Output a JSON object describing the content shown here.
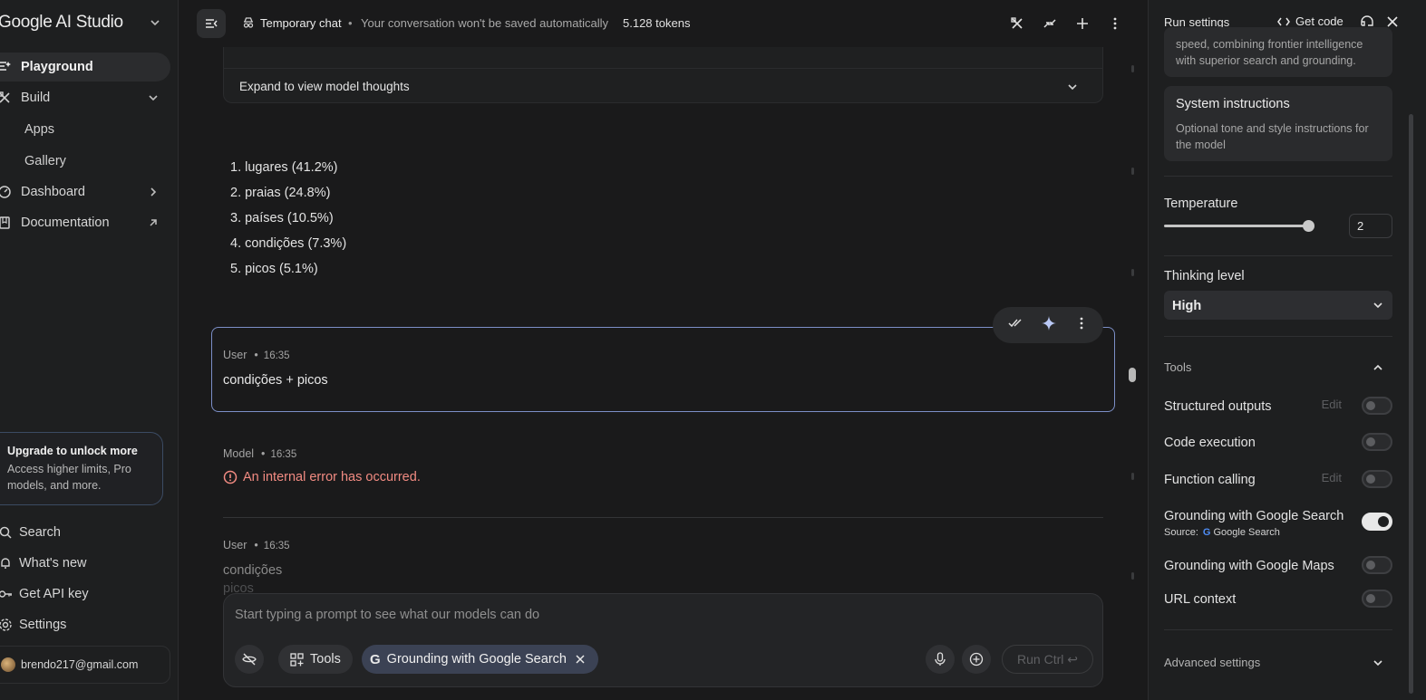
{
  "sidebar": {
    "brand": "Google AI Studio",
    "nav": {
      "playground": "Playground",
      "build": "Build",
      "apps": "Apps",
      "gallery": "Gallery",
      "dashboard": "Dashboard",
      "documentation": "Documentation"
    },
    "upgrade": {
      "title": "Upgrade to unlock more",
      "desc": "Access higher limits, Pro models, and more."
    },
    "bottom": {
      "search": "Search",
      "whats_new": "What's new",
      "api_key": "Get API key",
      "settings": "Settings"
    },
    "account_email": "brendo217@gmail.com"
  },
  "topbar": {
    "temp_title": "Temporary chat",
    "separator": "•",
    "temp_subtitle": "Your conversation won't be saved automatically",
    "tokens": "5.128 tokens"
  },
  "chat": {
    "thoughts_label": "Expand to view model thoughts",
    "list_items": [
      "1. lugares (41.2%)",
      "2. praias (24.8%)",
      "3. países (10.5%)",
      "4. condições (7.3%)",
      "5. picos (5.1%)"
    ],
    "messages": [
      {
        "role": "User",
        "time": "16:35",
        "text": "condições + picos"
      },
      {
        "role": "Model",
        "time": "16:35",
        "text": "An internal error has occurred."
      },
      {
        "role": "User",
        "time": "16:35",
        "text": "condições",
        "text2": "picos"
      }
    ],
    "dot": "•"
  },
  "prompt": {
    "placeholder": "Start typing a prompt to see what our models can do",
    "tools_label": "Tools",
    "grounding_chip": "Grounding with Google Search",
    "run_label": "Run Ctrl ↩"
  },
  "run_settings": {
    "title": "Run settings",
    "get_code": "Get code",
    "model_desc": "speed, combining frontier intelligence with superior search and grounding.",
    "system_instructions_title": "System instructions",
    "system_instructions_desc": "Optional tone and style instructions for the model",
    "temperature_label": "Temperature",
    "temperature_value": "2",
    "temperature_fraction": 1.0,
    "thinking_label": "Thinking level",
    "thinking_value": "High",
    "tools_heading": "Tools",
    "edit_label": "Edit",
    "tools": [
      {
        "name": "Structured outputs",
        "edit": true,
        "on": false
      },
      {
        "name": "Code execution",
        "edit": false,
        "on": false
      },
      {
        "name": "Function calling",
        "edit": true,
        "on": false
      },
      {
        "name": "Grounding with Google Search",
        "edit": false,
        "on": true
      },
      {
        "name": "Grounding with Google Maps",
        "edit": false,
        "on": false
      },
      {
        "name": "URL context",
        "edit": false,
        "on": false
      }
    ],
    "source_label": "Source:",
    "source_name": "Google Search",
    "advanced_label": "Advanced settings"
  },
  "colors": {
    "accent_border": "#7c8fc7",
    "error": "#f28b82",
    "chip_blue": "#3b4254"
  }
}
